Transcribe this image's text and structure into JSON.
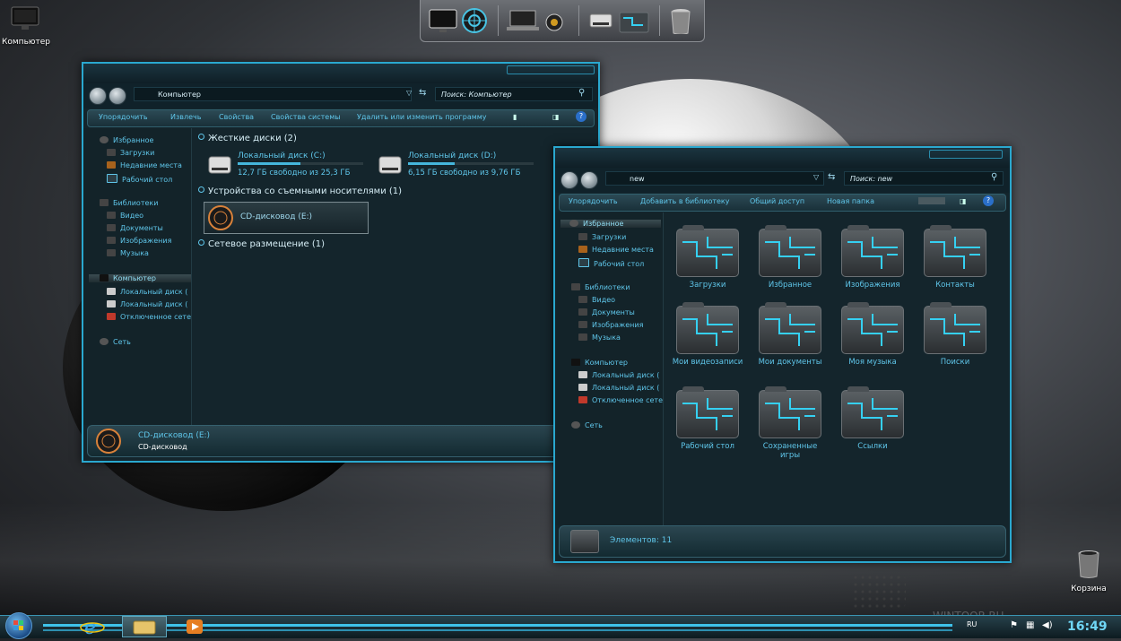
{
  "desktop": {
    "computer_label": "Компьютер",
    "recycle_label": "Корзина",
    "watermark": "WINTOOR.RU"
  },
  "win1": {
    "address": "Компьютер",
    "search_placeholder": "Поиск: Компьютер",
    "toolbar": [
      "Упорядочить",
      "Извлечь",
      "Свойства",
      "Свойства системы",
      "Удалить или изменить программу"
    ],
    "nav": [
      "Избранное",
      "Загрузки",
      "Недавние места",
      "Рабочий стол",
      "Библиотеки",
      "Видео",
      "Документы",
      "Изображения",
      "Музыка",
      "Компьютер",
      "Локальный диск (",
      "Локальный диск (",
      "Отключенное сете",
      "Сеть"
    ],
    "hard_drives_header": "Жесткие диски (2)",
    "drives": [
      {
        "name": "Локальный диск (C:)",
        "size": "12,7 ГБ свободно из 25,3 ГБ",
        "fill": 0.5
      },
      {
        "name": "Локальный диск (D:)",
        "size": "6,15 ГБ свободно из 9,76 ГБ",
        "fill": 0.37
      }
    ],
    "removable_header": "Устройства со съемными носителями (1)",
    "cd_name": "CD-дисковод (E:)",
    "network_header": "Сетевое размещение (1)",
    "status_title": "CD-дисковод (E:)",
    "status_sub": "CD-дисковод"
  },
  "win2": {
    "address": "new",
    "search_placeholder": "Поиск: new",
    "toolbar": [
      "Упорядочить",
      "Добавить в библиотеку",
      "Общий доступ",
      "Новая папка"
    ],
    "nav": [
      "Избранное",
      "Загрузки",
      "Недавние места",
      "Рабочий стол",
      "Библиотеки",
      "Видео",
      "Документы",
      "Изображения",
      "Музыка",
      "Компьютер",
      "Локальный диск (",
      "Локальный диск (",
      "Отключенное сете",
      "Сеть"
    ],
    "folders": [
      "Загрузки",
      "Избранное",
      "Изображения",
      "Контакты",
      "Мои видеозаписи",
      "Мои документы",
      "Моя музыка",
      "Поиски",
      "Рабочий стол",
      "Сохраненные игры",
      "Ссылки"
    ],
    "status_text": "Элементов: 11"
  },
  "taskbar": {
    "lang": "RU",
    "clock": "16:49"
  },
  "colors": {
    "accent": "#2aa8cf",
    "text": "#5fc6ea",
    "window_bg": "#14252c"
  }
}
